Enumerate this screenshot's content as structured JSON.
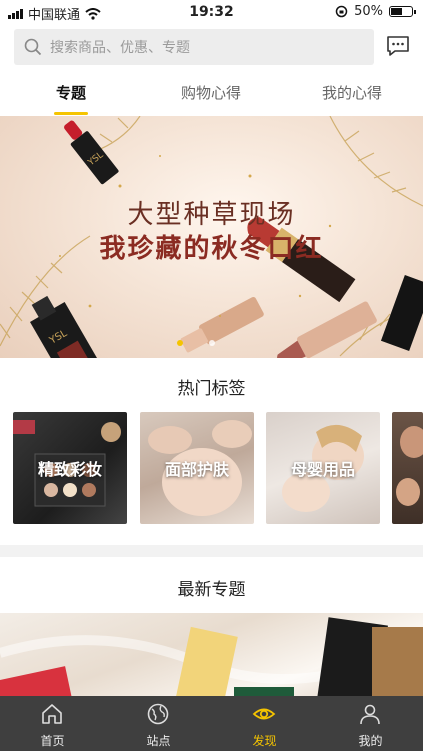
{
  "status_bar": {
    "carrier": "中国联通",
    "time": "19:32",
    "battery": "50%"
  },
  "search": {
    "placeholder": "搜索商品、优惠、专题"
  },
  "tabs": [
    {
      "label": "专题",
      "active": true
    },
    {
      "label": "购物心得",
      "active": false
    },
    {
      "label": "我的心得",
      "active": false
    }
  ],
  "banner": {
    "line1": "大型种草现场",
    "line2": "我珍藏的秋冬口红",
    "slide_count": 2,
    "active_slide": 1
  },
  "hot_tags": {
    "title": "热门标签",
    "items": [
      {
        "label": "精致彩妆"
      },
      {
        "label": "面部护肤"
      },
      {
        "label": "母婴用品"
      }
    ]
  },
  "newest": {
    "title": "最新专题"
  },
  "bottom_nav": [
    {
      "label": "首页",
      "icon": "home-icon",
      "active": false
    },
    {
      "label": "站点",
      "icon": "globe-icon",
      "active": false
    },
    {
      "label": "发现",
      "icon": "eye-icon",
      "active": true
    },
    {
      "label": "我的",
      "icon": "user-icon",
      "active": false
    }
  ],
  "colors": {
    "accent": "#f5c400",
    "nav_bg": "#3f3f3f",
    "banner_text": "#8b2b22"
  }
}
